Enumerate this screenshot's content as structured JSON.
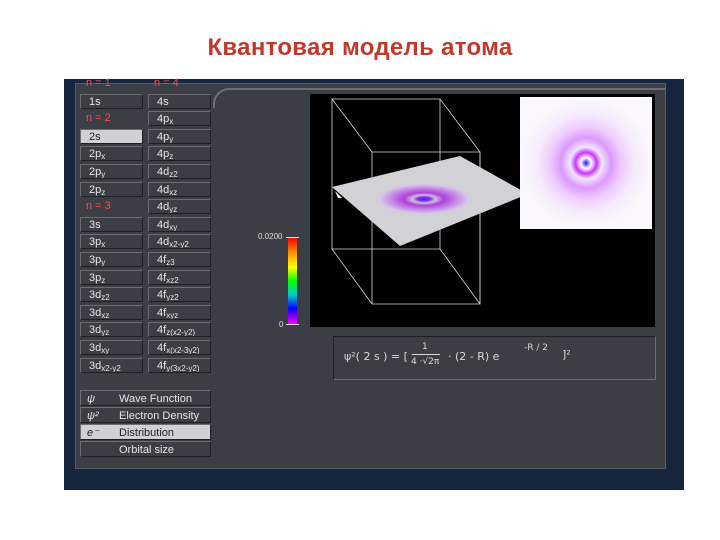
{
  "title": "Квантовая модель атома",
  "left_column": [
    {
      "label": "n = 1",
      "header": true
    },
    {
      "label": "1s"
    },
    {
      "label": "n = 2",
      "header": true
    },
    {
      "label": "2s",
      "selected": true
    },
    {
      "label": "2p",
      "sub": "x"
    },
    {
      "label": "2p",
      "sub": "y"
    },
    {
      "label": "2p",
      "sub": "z"
    },
    {
      "label": "n = 3",
      "header": true
    },
    {
      "label": "3s"
    },
    {
      "label": "3p",
      "sub": "x"
    },
    {
      "label": "3p",
      "sub": "y"
    },
    {
      "label": "3p",
      "sub": "z"
    },
    {
      "label": "3d",
      "sub": "z2"
    },
    {
      "label": "3d",
      "sub": "xz"
    },
    {
      "label": "3d",
      "sub": "yz"
    },
    {
      "label": "3d",
      "sub": "xy"
    },
    {
      "label": "3d",
      "sub": "x2-y2"
    }
  ],
  "right_column": [
    {
      "label": "n = 4",
      "header": true
    },
    {
      "label": "4s"
    },
    {
      "label": "4p",
      "sub": "x"
    },
    {
      "label": "4p",
      "sub": "y"
    },
    {
      "label": "4p",
      "sub": "z"
    },
    {
      "label": "4d",
      "sub": "z2"
    },
    {
      "label": "4d",
      "sub": "xz"
    },
    {
      "label": "4d",
      "sub": "yz"
    },
    {
      "label": "4d",
      "sub": "xy"
    },
    {
      "label": "4d",
      "sub": "x2-y2"
    },
    {
      "label": "4f",
      "sub": "z3"
    },
    {
      "label": "4f",
      "sub": "xz2"
    },
    {
      "label": "4f",
      "sub": "yz2"
    },
    {
      "label": "4f",
      "sub": "xyz"
    },
    {
      "label": "4f",
      "sub": "z(x2-y2)"
    },
    {
      "label": "4f",
      "sub": "x(x2-3y2)"
    },
    {
      "label": "4f",
      "sub": "y(3x2-y2)"
    }
  ],
  "modes": [
    {
      "symbol": "ψ",
      "label": "Wave Function"
    },
    {
      "symbol": "ψ²",
      "label": "Electron Density"
    },
    {
      "symbol": "e⁻",
      "label": "Distribution",
      "selected": true
    },
    {
      "symbol": "",
      "label": "Orbital size"
    }
  ],
  "colorbar": {
    "max_label": "0.0200",
    "min_label": "0"
  },
  "formula": {
    "lhs": "ψ²( 2 s ) = [",
    "num": "1",
    "den": "4 ·√2π",
    "mid": "· (2 - R)  e",
    "exp": "-R / 2",
    "rhs": "]²"
  },
  "colors": {
    "selected": "#cfd1d6",
    "panel": "#3c3e45",
    "header_text": "#ff4b4b",
    "density": "#b040d8"
  }
}
